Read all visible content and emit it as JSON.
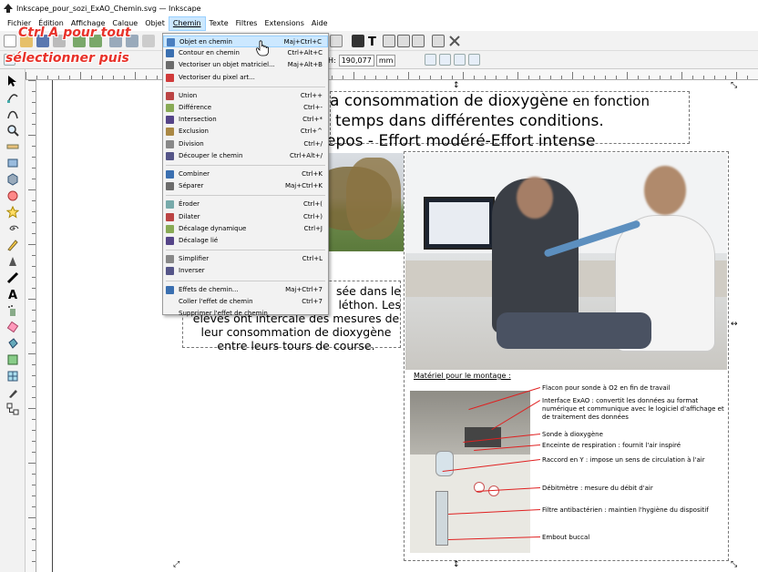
{
  "window": {
    "title": "Inkscape_pour_sozi_ExAO_Chemin.svg — Inkscape"
  },
  "menubar": [
    {
      "label": "Fichier",
      "active": false
    },
    {
      "label": "Édition",
      "active": false
    },
    {
      "label": "Affichage",
      "active": false
    },
    {
      "label": "Calque",
      "active": false
    },
    {
      "label": "Objet",
      "active": false
    },
    {
      "label": "Chemin",
      "active": true
    },
    {
      "label": "Texte",
      "active": false
    },
    {
      "label": "Filtres",
      "active": false
    },
    {
      "label": "Extensions",
      "active": false
    },
    {
      "label": "Aide",
      "active": false
    }
  ],
  "toolbar": {
    "h_label": "H:",
    "h_value": "190,077",
    "unit": "mm"
  },
  "annotations": {
    "line1": "Ctrl A pour tout",
    "line2": "sélectionner puis"
  },
  "menu_items": [
    {
      "label": "Objet en chemin",
      "shortcut": "Maj+Ctrl+C",
      "icon": "object-to-path-icon",
      "highlighted": true
    },
    {
      "label": "Contour en chemin",
      "shortcut": "Ctrl+Alt+C",
      "icon": "stroke-to-path-icon"
    },
    {
      "label": "Vectoriser un objet matriciel...",
      "shortcut": "Maj+Alt+B",
      "icon": "trace-bitmap-icon"
    },
    {
      "label": "Vectoriser du pixel art...",
      "shortcut": "",
      "icon": "trace-pixel-art-icon"
    },
    {
      "sep": true
    },
    {
      "label": "Union",
      "shortcut": "Ctrl++",
      "icon": "union-icon"
    },
    {
      "label": "Différence",
      "shortcut": "Ctrl+-",
      "icon": "difference-icon"
    },
    {
      "label": "Intersection",
      "shortcut": "Ctrl+*",
      "icon": "intersection-icon"
    },
    {
      "label": "Exclusion",
      "shortcut": "Ctrl+^",
      "icon": "exclusion-icon"
    },
    {
      "label": "Division",
      "shortcut": "Ctrl+/",
      "icon": "division-icon"
    },
    {
      "label": "Découper le chemin",
      "shortcut": "Ctrl+Alt+/",
      "icon": "cut-path-icon"
    },
    {
      "sep": true
    },
    {
      "label": "Combiner",
      "shortcut": "Ctrl+K",
      "icon": "combine-icon"
    },
    {
      "label": "Séparer",
      "shortcut": "Maj+Ctrl+K",
      "icon": "break-apart-icon"
    },
    {
      "sep": true
    },
    {
      "label": "Éroder",
      "shortcut": "Ctrl+(",
      "icon": "inset-icon"
    },
    {
      "label": "Dilater",
      "shortcut": "Ctrl+)",
      "icon": "outset-icon"
    },
    {
      "label": "Décalage dynamique",
      "shortcut": "Ctrl+J",
      "icon": "dynamic-offset-icon"
    },
    {
      "label": "Décalage lié",
      "shortcut": "",
      "icon": "linked-offset-icon"
    },
    {
      "sep": true
    },
    {
      "label": "Simplifier",
      "shortcut": "Ctrl+L",
      "icon": "simplify-icon"
    },
    {
      "label": "Inverser",
      "shortcut": "",
      "icon": "reverse-icon"
    },
    {
      "sep": true
    },
    {
      "label": "Effets de chemin...",
      "shortcut": "Maj+Ctrl+7",
      "icon": "path-effects-icon"
    },
    {
      "label": "Coller l'effet de chemin",
      "shortcut": "Ctrl+7",
      "icon": ""
    },
    {
      "label": "Supprimer l'effet de chemin",
      "shortcut": "",
      "icon": ""
    }
  ],
  "canvas": {
    "heading_line1_a": "a consommation de dioxygène",
    "heading_line1_b": " en fonction",
    "heading_line2": "temps  dans différentes conditions.",
    "heading_line3": "epos - Effort modéré-Effort intense",
    "paragraph_lines": [
      "sée dans le",
      "léthon. Les",
      "élèves ont intercalé des mesures de",
      "leur consommation de dioxygène",
      "entre leurs tours de course."
    ],
    "materials_title": "Matériel pour le montage  :",
    "labels": [
      "Flacon pour sonde à O2 en fin de travail",
      "Interface ExAO : convertit les données au format numérique et communique avec le logiciel d'affichage et de traitement des données",
      "Sonde à dioxygène",
      "Enceinte de respiration : fournit  l'air inspiré",
      "Raccord en Y : impose un sens de circulation à l'air",
      "Débitmètre  : mesure du débit d'air",
      "Filtre antibactérien  : maintien l'hygiène du dispositif",
      "Embout buccal"
    ]
  },
  "colors": {
    "menu_highlight": "#cce8ff",
    "annotation": "#e8322a",
    "arrow": "#e02020"
  }
}
